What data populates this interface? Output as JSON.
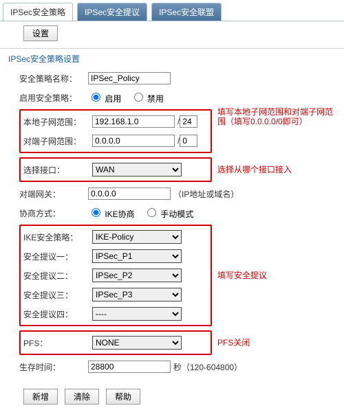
{
  "tabs": {
    "t1": "IPSec安全策略",
    "t2": "IPSec安全提议",
    "t3": "IPSec安全联盟"
  },
  "settings_btn": "设置",
  "panel_title": "IPSec安全策略设置",
  "policy_name_label": "安全策略名称：",
  "policy_name_value": "IPSec_Policy",
  "enable_label": "启用安全策略：",
  "enable_opt_on": "启用",
  "enable_opt_off": "禁用",
  "local_net_label": "本地子网范围：",
  "local_net_ip": "192.168.1.0",
  "local_net_cidr": "24",
  "remote_net_label": "对端子网范围：",
  "remote_net_ip": "0.0.0.0",
  "remote_net_cidr": "0",
  "iface_label": "选择接口：",
  "iface_value": "WAN",
  "peer_gw_label": "对端网关：",
  "peer_gw_value": "0.0.0.0",
  "peer_gw_hint": "（IP地址或域名）",
  "nego_label": "协商方式：",
  "nego_opt_ike": "IKE协商",
  "nego_opt_manual": "手动模式",
  "ike_policy_label": "IKE安全策略：",
  "ike_policy_value": "IKE-Policy",
  "p1_label": "安全提议一：",
  "p1_value": "IPSec_P1",
  "p2_label": "安全提议二：",
  "p2_value": "IPSec_P2",
  "p3_label": "安全提议三：",
  "p3_value": "IPSec_P3",
  "p4_label": "安全提议四：",
  "p4_value": "----",
  "pfs_label": "PFS：",
  "pfs_value": "NONE",
  "lifetime_label": "生存时间：",
  "lifetime_value": "28800",
  "lifetime_suffix": "秒（120-604800）",
  "btn_add": "新增",
  "btn_clear": "清除",
  "btn_help": "帮助",
  "annot_subnet": "填写本地子网范围和对端子网范围（填写0.0.0.0/0即可）",
  "annot_iface": "选择从哪个接口接入",
  "annot_proposal": "填写安全提议",
  "annot_pfs": "PFS关闭"
}
